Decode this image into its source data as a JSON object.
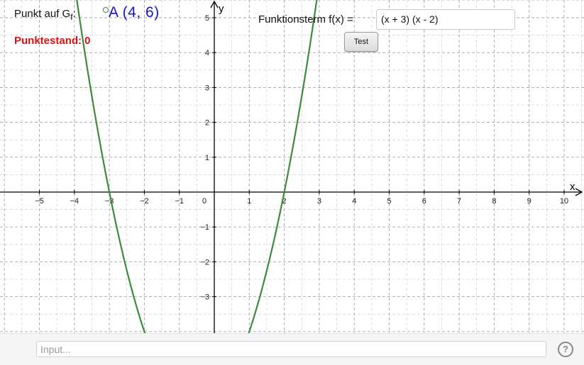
{
  "point_panel": {
    "label": "Punkt auf G",
    "label_sub": "f",
    "label_colon": ":",
    "point_value": "A  (4, 6)"
  },
  "score": {
    "text": "Punktestand: 0"
  },
  "function_panel": {
    "label": "Funktionsterm f(x) =",
    "input_value": "(x + 3) (x - 2)",
    "test_button": "Test"
  },
  "input_bar": {
    "placeholder": "Input...",
    "help_label": "?"
  },
  "colors": {
    "curve": "#3d8b3d",
    "point_text": "#1515cc",
    "score_text": "#dd1111",
    "grid": "#9a9a9a",
    "axes": "#000000"
  },
  "chart_data": {
    "type": "line",
    "function": "(x + 3)(x - 2)",
    "xlabel": "x",
    "ylabel": "y",
    "xlim": [
      -6.0,
      10.5
    ],
    "ylim": [
      -4.0,
      5.0
    ],
    "x_ticks": [
      -5,
      -4,
      -3,
      -2,
      -1,
      0,
      1,
      2,
      3,
      4,
      5,
      6,
      7,
      8,
      9,
      10
    ],
    "y_ticks": [
      -3,
      -2,
      -1,
      1,
      2,
      3,
      4,
      5
    ],
    "grid": true,
    "grid_style": "dashed"
  }
}
